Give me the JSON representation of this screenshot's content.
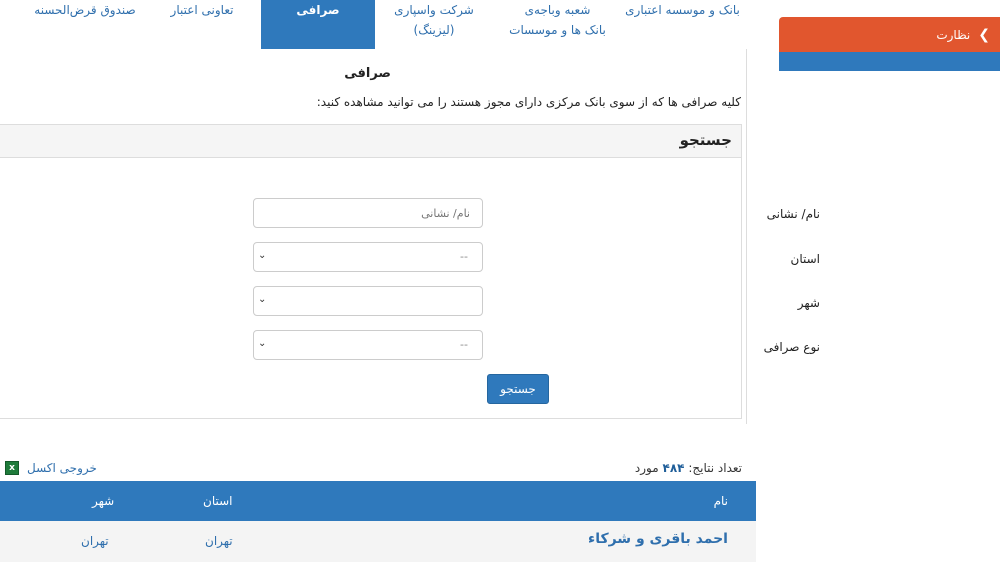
{
  "sidebar": {
    "item_label": "نظارت"
  },
  "tabs": [
    {
      "line1": "بانک و موسسه اعتباری",
      "line2": ""
    },
    {
      "line1": "شعبه وباجه‌ی",
      "line2": "بانک ها و موسسات"
    },
    {
      "line1": "شرکت واسپاری",
      "line2": "(لیزینگ)"
    },
    {
      "line1": "صرافی",
      "line2": ""
    },
    {
      "line1": "تعاونی اعتبار",
      "line2": ""
    },
    {
      "line1": "صندوق قرض‌الحسنه",
      "line2": ""
    }
  ],
  "main": {
    "title": "صرافی",
    "description": "کلیه صرافی ها که از سوی بانک مرکزی دارای مجوز هستند را می توانید مشاهده کنید:"
  },
  "search": {
    "heading": "جستجو",
    "name_label": "نام/ نشانی",
    "name_placeholder": "نام/ نشانی",
    "province_label": "استان",
    "province_value": "--",
    "city_label": "شهر",
    "city_value": "",
    "type_label": "نوع صرافی",
    "type_value": "--",
    "button_label": "جستجو"
  },
  "results": {
    "count_prefix": "تعداد نتایج:",
    "count_value": "۴۸۴",
    "count_suffix": "مورد",
    "excel_label": "خروجی اکسل",
    "columns": {
      "name": "نام",
      "province": "استان",
      "city": "شهر"
    },
    "rows": [
      {
        "name": "احمد باقری و شرکاء",
        "province": "تهران",
        "city": "تهران"
      }
    ]
  },
  "colors": {
    "accent": "#2f79bc",
    "sidebar_active": "#e1562e"
  }
}
